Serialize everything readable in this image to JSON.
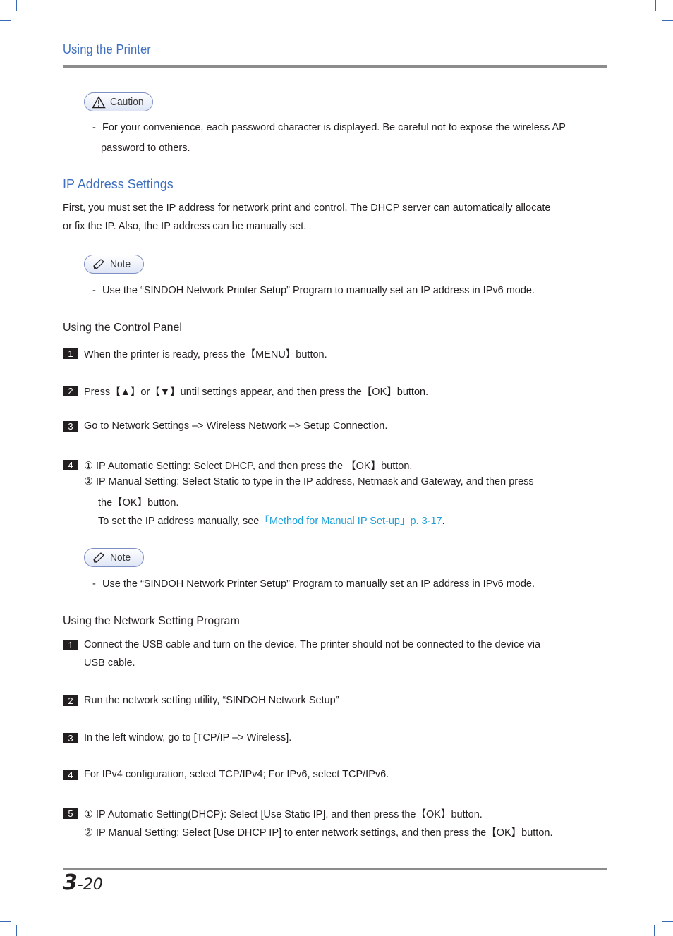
{
  "header": {
    "title": "Using the Printer"
  },
  "caution": {
    "label": "Caution",
    "bullet_dash": "-",
    "line1": "For your convenience, each password character is displayed. Be careful not to expose the wireless AP",
    "line2": "password to others."
  },
  "ip_section": {
    "title": "IP Address Settings",
    "para_line1": "First, you must set the IP address for network print and control. The DHCP server can automatically allocate",
    "para_line2": "or fix the IP. Also, the IP address can be manually set."
  },
  "note1": {
    "label": "Note",
    "bullet_dash": "-",
    "text": "Use the “SINDOH Network Printer Setup” Program to manually set an IP address in IPv6 mode."
  },
  "control_panel": {
    "title": "Using the Control Panel",
    "steps": [
      {
        "num": "1",
        "text": "When the printer is ready, press the【MENU】button."
      },
      {
        "num": "2",
        "text": "Press【▲】or【▼】until settings appear, and then press the【OK】button."
      },
      {
        "num": "3",
        "text": "Go to Network Settings ­–> Wireless Network –> Setup Connection."
      },
      {
        "num": "4",
        "text": "① IP Automatic Setting: Select DHCP, and then press the 【OK】button."
      }
    ],
    "step4_line2": "② IP Manual Setting: Select Static to type in the IP address, Netmask and Gateway, and then press",
    "step4_line3": "the【OK】button.",
    "step4_line4_prefix": "To set the IP address manually, see",
    "step4_link": "「Method for Manual IP Set-up」p. 3-17",
    "step4_line4_suffix": "."
  },
  "note2": {
    "label": "Note",
    "bullet_dash": "-",
    "text": "Use the “SINDOH Network Printer Setup” Program to manually set an IP address in IPv6 mode."
  },
  "network_program": {
    "title": "Using the Network Setting Program",
    "steps": [
      {
        "num": "1",
        "text": "Connect the USB cable and turn on the device. The printer should not be connected to the device via"
      },
      {
        "num": "2",
        "text": "Run the network setting utility, “SINDOH Network Setup”"
      },
      {
        "num": "3",
        "text": "In the left window, go to [TCP/IP –> Wireless]."
      },
      {
        "num": "4",
        "text": "For IPv4 configuration, select TCP/IPv4; For IPv6, select TCP/IPv6."
      },
      {
        "num": "5",
        "text": "① IP Automatic Setting(DHCP): Select [Use Static IP], and then press the【OK】button."
      }
    ],
    "step1_line2": "USB cable.",
    "step5_line2": "② IP Manual Setting: Select [Use DHCP IP] to enter network settings, and then press the【OK】button."
  },
  "footer": {
    "chapter": "3",
    "page": "-20"
  },
  "colors": {
    "accent": "#3f6fc1",
    "link": "#1ea1d8",
    "rule": "#8c8c8c"
  }
}
